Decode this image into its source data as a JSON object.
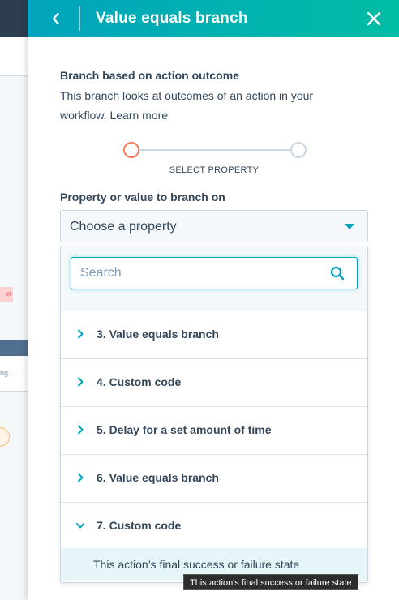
{
  "background": {
    "badge_text": "et",
    "card_text": "ng..."
  },
  "panel": {
    "title": "Value equals branch",
    "back_icon": "chevron-left-icon",
    "close_icon": "close-icon"
  },
  "branch": {
    "heading": "Branch based on action outcome",
    "description": "This branch looks at outcomes of an action in your workflow.",
    "learn_more": "Learn more"
  },
  "stepper": {
    "current_step_label": "SELECT PROPERTY"
  },
  "property_field": {
    "label": "Property or value to branch on",
    "value": "Choose a property"
  },
  "dropdown": {
    "search_placeholder": "Search",
    "groups": [
      {
        "label": "3. Value equals branch",
        "expanded": false
      },
      {
        "label": "4. Custom code",
        "expanded": false
      },
      {
        "label": "5. Delay for a set amount of time",
        "expanded": false
      },
      {
        "label": "6. Value equals branch",
        "expanded": false
      },
      {
        "label": "7. Custom code",
        "expanded": true
      }
    ],
    "options": [
      {
        "label": "This action’s final success or failure state"
      }
    ]
  },
  "tooltip": {
    "text": "This action's final success or failure state"
  },
  "colors": {
    "header_start": "#00a4bd",
    "header_end": "#00bda5",
    "accent": "#00a4bd",
    "step_active": "#ff7a59",
    "text": "#33475b"
  }
}
